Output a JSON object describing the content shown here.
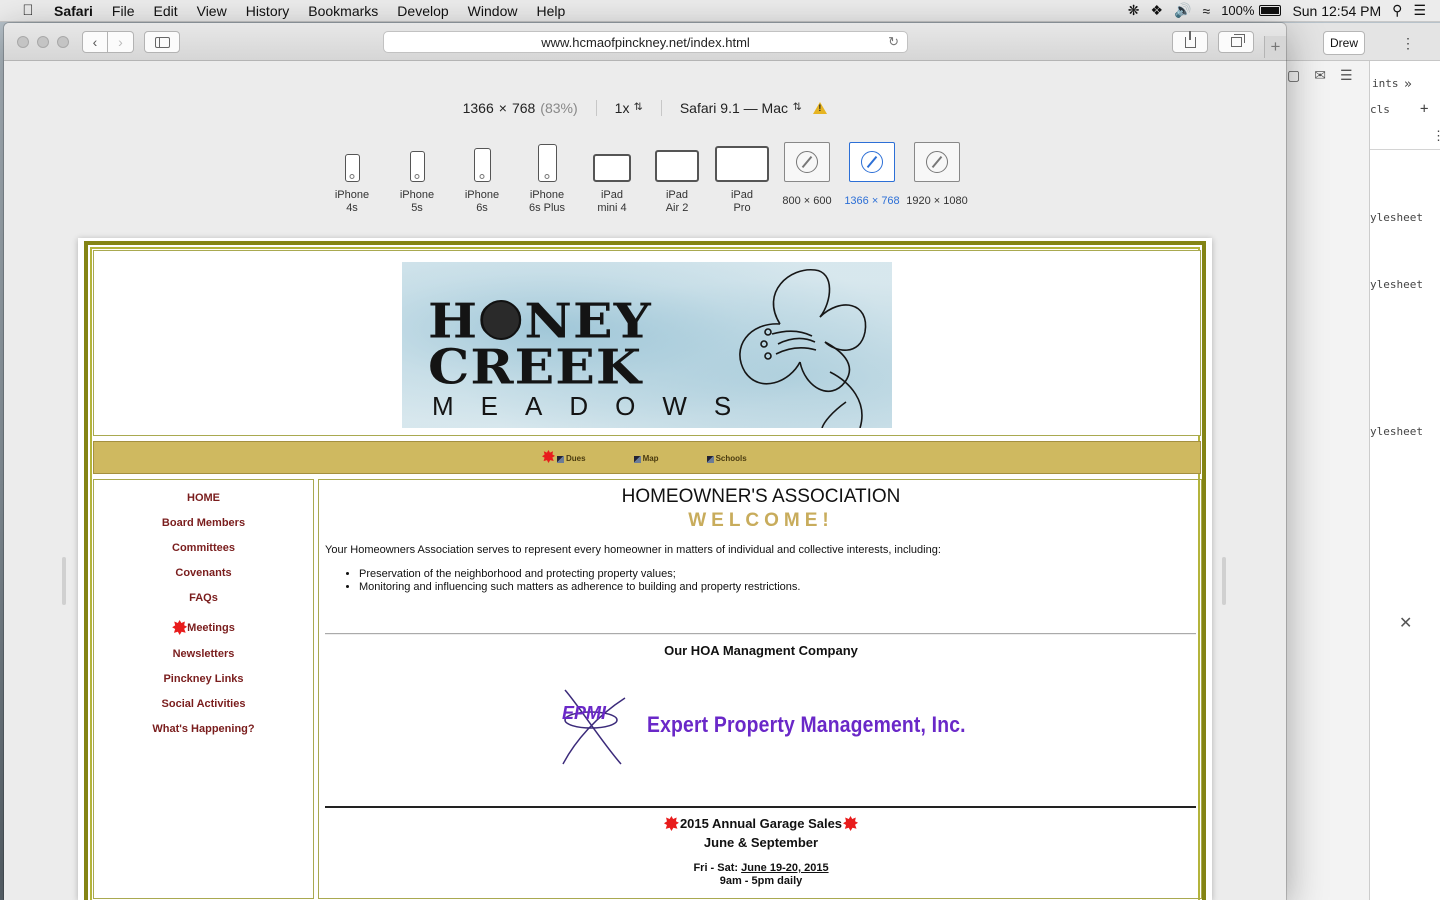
{
  "menubar": {
    "app": "Safari",
    "items": [
      "File",
      "Edit",
      "View",
      "History",
      "Bookmarks",
      "Develop",
      "Window",
      "Help"
    ],
    "battery": "100%",
    "clock": "Sun 12:54 PM"
  },
  "browser": {
    "url": "www.hcmaofpinckney.net/index.html",
    "devtools_user_button": "Drew"
  },
  "rdm": {
    "width": "1366",
    "times": "×",
    "height": "768",
    "scale_percent": "(83%)",
    "pixel_ratio": "1x",
    "user_agent": "Safari 9.1 — Mac",
    "devices": [
      {
        "line1": "iPhone",
        "line2": "4s"
      },
      {
        "line1": "iPhone",
        "line2": "5s"
      },
      {
        "line1": "iPhone",
        "line2": "6s"
      },
      {
        "line1": "iPhone",
        "line2": "6s Plus"
      },
      {
        "line1": "iPad",
        "line2": "mini 4"
      },
      {
        "line1": "iPad",
        "line2": "Air 2"
      },
      {
        "line1": "iPad",
        "line2": "Pro"
      },
      {
        "line1": "800 × 600",
        "line2": ""
      },
      {
        "line1": "1366 × 768",
        "line2": "",
        "selected": true
      },
      {
        "line1": "1920 × 1080",
        "line2": ""
      }
    ]
  },
  "devtools_side": {
    "tab_ints": "ints",
    "tab_cls": "cls",
    "stylesheet_labels": [
      "ylesheet",
      "ylesheet",
      "ylesheet"
    ]
  },
  "site": {
    "logo": {
      "line1": "HONEY",
      "line2": "CREEK",
      "line3": "MEADOWS"
    },
    "topnav": [
      "Dues",
      "Map",
      "Schools"
    ],
    "leftnav": [
      "HOME",
      "Board Members",
      "Committees",
      "Covenants",
      "FAQs",
      "Meetings",
      "Newsletters",
      "Pinckney Links",
      "Social Activities",
      "What's Happening?"
    ],
    "heading": "HOMEOWNER'S ASSOCIATION",
    "welcome": "WELCOME!",
    "intro": "Your Homeowners Association serves to represent every homeowner in matters of individual and collective interests, including:",
    "bullets": [
      "Preservation of the neighborhood and protecting property values;",
      "Monitoring and influencing such matters as adherence to building and property restrictions."
    ],
    "mgmt_heading": "Our HOA Managment Company",
    "mgmt_logo_text": "EPMI",
    "mgmt_name": "Expert Property Management, Inc.",
    "garage_title": "2015 Annual Garage Sales",
    "garage_months": "June & September",
    "garage_dates_prefix": "Fri - Sat: ",
    "garage_dates": "June 19-20, 2015",
    "garage_hours": "9am - 5pm daily"
  },
  "colors": {
    "site_border": "#848414",
    "nav_strip": "#cfb960",
    "link_maroon": "#7a1d1d",
    "welcome_gold": "#c8ac5c",
    "epmi_purple": "#6a28c8",
    "selected_device": "#2c6fd6"
  }
}
